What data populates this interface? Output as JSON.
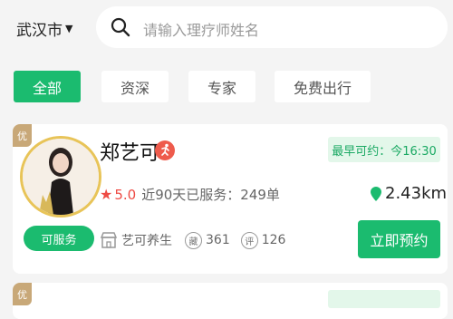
{
  "header": {
    "city": "武汉市",
    "city_arrow": "▼",
    "search_placeholder": "请输入理疗师姓名"
  },
  "filters": [
    "全部",
    "资深",
    "专家",
    "免费出行"
  ],
  "active_filter": "全部",
  "therapist": {
    "badge": "优",
    "name": "郑艺可",
    "earliest_label": "最早可约：今16:30",
    "rating": "5.0",
    "served_text": "近90天已服务：249单",
    "distance": "2.43km",
    "service_tag": "可服务",
    "shop_name": "艺可养生",
    "favorites_icon": "藏",
    "favorites_count": "361",
    "reviews_icon": "评",
    "reviews_count": "126",
    "book_label": "立即预约"
  },
  "next_card": {
    "badge": "优"
  },
  "colors": {
    "accent": "#1bbb6f",
    "rating": "#ee4b44",
    "gold_badge": "#c8a878",
    "earliest_bg": "#e3f7ea"
  },
  "icons": [
    "search-icon",
    "chevron-down-icon",
    "run-icon",
    "star-icon",
    "location-pin-icon",
    "shop-icon",
    "favorite-icon",
    "review-icon"
  ]
}
